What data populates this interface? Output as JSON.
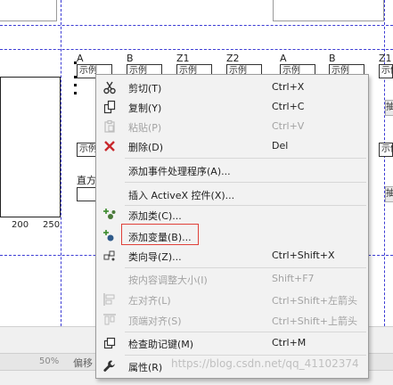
{
  "designer": {
    "column_headers": [
      "A",
      "B",
      "Z1",
      "Z2",
      "A",
      "B",
      "Z1"
    ],
    "field_label": "示例",
    "axis_ticks": [
      "200",
      "250"
    ],
    "side_labels": [
      "示例",
      "直方"
    ],
    "side_buttons": [
      "抽",
      "抽"
    ],
    "guide_color": "#3b3bd4"
  },
  "status": {
    "zoom": "50%",
    "offset": "偏移"
  },
  "context_menu": {
    "items": [
      {
        "label": "剪切(T)",
        "shortcut": "Ctrl+X",
        "icon": "scissors-icon",
        "enabled": true
      },
      {
        "label": "复制(Y)",
        "shortcut": "Ctrl+C",
        "icon": "copy-icon",
        "enabled": true
      },
      {
        "label": "粘贴(P)",
        "shortcut": "Ctrl+V",
        "icon": "paste-icon",
        "enabled": false
      },
      {
        "label": "删除(D)",
        "shortcut": "Del",
        "icon": "delete-x-icon",
        "enabled": true
      },
      {
        "label": "添加事件处理程序(A)...",
        "shortcut": "",
        "icon": "",
        "enabled": true
      },
      {
        "label": "插入 ActiveX 控件(X)...",
        "shortcut": "",
        "icon": "",
        "enabled": true
      },
      {
        "label": "添加类(C)...",
        "shortcut": "",
        "icon": "add-class-icon",
        "enabled": true
      },
      {
        "label": "添加变量(B)...",
        "shortcut": "",
        "icon": "add-variable-icon",
        "enabled": true
      },
      {
        "label": "类向导(Z)...",
        "shortcut": "Ctrl+Shift+X",
        "icon": "class-wizard-icon",
        "enabled": true
      },
      {
        "label": "按内容调整大小(I)",
        "shortcut": "Shift+F7",
        "icon": "",
        "enabled": false
      },
      {
        "label": "左对齐(L)",
        "shortcut": "Ctrl+Shift+左箭头",
        "icon": "align-left-icon",
        "enabled": false
      },
      {
        "label": "顶端对齐(S)",
        "shortcut": "Ctrl+Shift+上箭头",
        "icon": "align-top-icon",
        "enabled": false
      },
      {
        "label": "检查助记键(M)",
        "shortcut": "Ctrl+M",
        "icon": "check-mnemonics-icon",
        "enabled": true
      },
      {
        "label": "属性(R)",
        "shortcut": "",
        "icon": "wrench-icon",
        "enabled": true
      }
    ],
    "highlight_color": "#e0413a"
  },
  "watermark": "https://blog.csdn.net/qq_41102374"
}
